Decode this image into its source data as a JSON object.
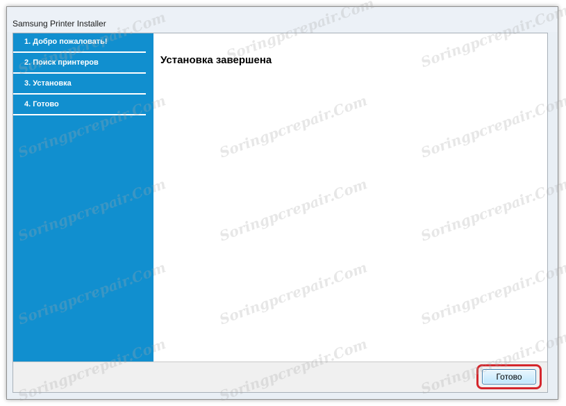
{
  "window": {
    "title": "Samsung Printer Installer"
  },
  "sidebar": {
    "steps": [
      {
        "label": "1. Добро пожаловать!"
      },
      {
        "label": "2. Поиск принтеров"
      },
      {
        "label": "3. Установка"
      },
      {
        "label": "4. Готово"
      }
    ]
  },
  "main": {
    "heading": "Установка завершена"
  },
  "footer": {
    "finish_label": "Готово"
  },
  "watermark": {
    "text": "Soringpcrepair.Com"
  },
  "colors": {
    "sidebar": "#118fcf",
    "highlight": "#d4262c"
  }
}
